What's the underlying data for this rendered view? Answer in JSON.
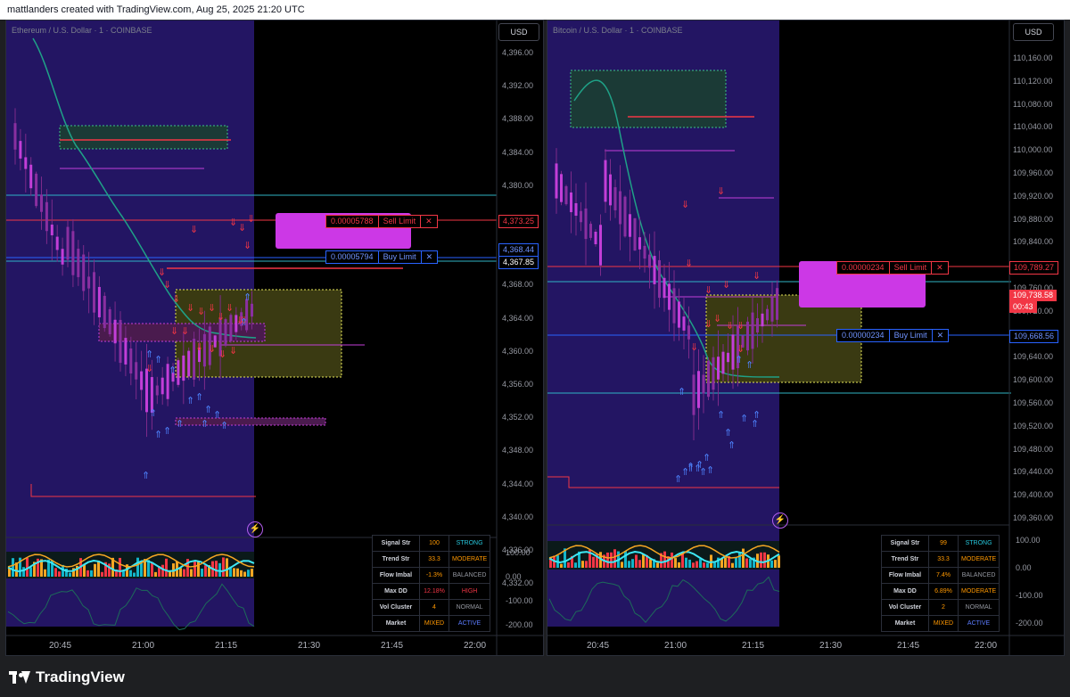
{
  "header": {
    "credit": "mattlanders created with TradingView.com, Aug 25, 2025 21:20 UTC"
  },
  "footer": {
    "brand": "TradingView"
  },
  "left_chart": {
    "symbol": "Ethereum / U.S. Dollar · 1 · COINBASE",
    "currency": "USD",
    "price_ticks": [
      "4,396.00",
      "4,392.00",
      "4,388.00",
      "4,384.00",
      "4,380.00",
      "4,376.00",
      "4,372.00",
      "4,368.00",
      "4,364.00",
      "4,360.00",
      "4,356.00",
      "4,352.00",
      "4,348.00",
      "4,344.00",
      "4,340.00",
      "4,336.00",
      "4,332.00"
    ],
    "osc_ticks": [
      "100.00",
      "0.00",
      "-100.00",
      "-200.00"
    ],
    "time_ticks": [
      "20:45",
      "21:00",
      "21:15",
      "21:30",
      "21:45",
      "22:00"
    ],
    "price_tags": {
      "sell": "4,373.25",
      "mid": "4,368.44",
      "last": "4,367.85"
    },
    "orders": [
      {
        "qty": "0.00005788",
        "label": "Sell Limit",
        "close": "✕"
      },
      {
        "qty": "0.00005794",
        "label": "Buy Limit",
        "close": "✕"
      }
    ],
    "signal_table": [
      {
        "label": "Signal Str",
        "value": "100",
        "status": "STRONG"
      },
      {
        "label": "Trend Str",
        "value": "33.3",
        "status": "MODERATE"
      },
      {
        "label": "Flow Imbal",
        "value": "-1.3%",
        "status": "BALANCED"
      },
      {
        "label": "Max DD",
        "value": "12.18%",
        "status": "HIGH"
      },
      {
        "label": "Vol Cluster",
        "value": "4",
        "status": "NORMAL"
      },
      {
        "label": "Market",
        "value": "MIXED",
        "status": "ACTIVE"
      }
    ]
  },
  "right_chart": {
    "symbol": "Bitcoin / U.S. Dollar · 1 · COINBASE",
    "currency": "USD",
    "price_ticks": [
      "110,160.00",
      "110,120.00",
      "110,080.00",
      "110,040.00",
      "110,000.00",
      "109,960.00",
      "109,920.00",
      "109,880.00",
      "109,840.00",
      "109,800.00",
      "109,760.00",
      "109,720.00",
      "109,680.00",
      "109,640.00",
      "109,600.00",
      "109,560.00",
      "109,520.00",
      "109,480.00",
      "109,440.00",
      "109,400.00",
      "109,360.00"
    ],
    "osc_ticks": [
      "100.00",
      "0.00",
      "-100.00",
      "-200.00"
    ],
    "time_ticks": [
      "20:45",
      "21:00",
      "21:15",
      "21:30",
      "21:45",
      "22:00"
    ],
    "price_tags": {
      "sell": "109,789.27",
      "last": "109,738.58",
      "countdown": "00:43",
      "buy": "109,668.56"
    },
    "orders": [
      {
        "qty": "0.00000234",
        "label": "Sell Limit",
        "close": "✕"
      },
      {
        "qty": "0.00000234",
        "label": "Buy Limit",
        "close": "✕"
      }
    ],
    "signal_table": [
      {
        "label": "Signal Str",
        "value": "99",
        "status": "STRONG"
      },
      {
        "label": "Trend Str",
        "value": "33.3",
        "status": "MODERATE"
      },
      {
        "label": "Flow Imbal",
        "value": "7.4%",
        "status": "BALANCED"
      },
      {
        "label": "Max DD",
        "value": "6.89%",
        "status": "MODERATE"
      },
      {
        "label": "Vol Cluster",
        "value": "2",
        "status": "NORMAL"
      },
      {
        "label": "Market",
        "value": "MIXED",
        "status": "ACTIVE"
      }
    ]
  },
  "colors": {
    "sell": "#f23645",
    "buy": "#2962ff",
    "candle": "#c33ed8",
    "ma": "#1fa187",
    "session": "#2a1a6e",
    "zone": "#3a3a12",
    "teal_line": "#2fb3c4"
  }
}
